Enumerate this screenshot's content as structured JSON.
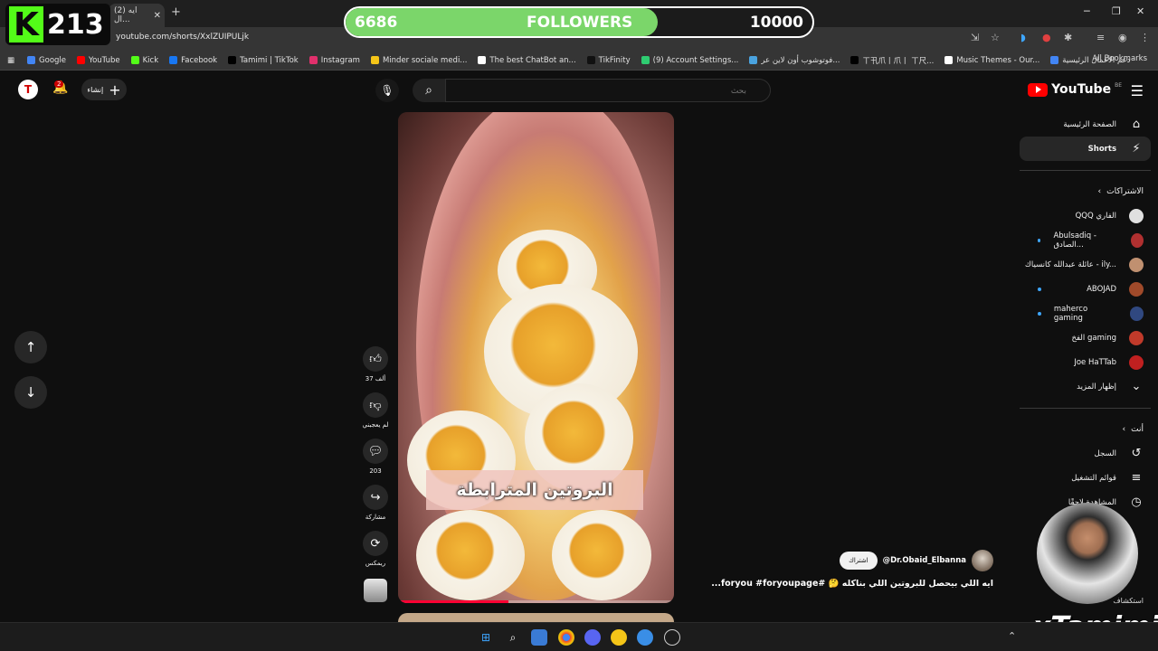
{
  "browser": {
    "tab_title": "(2) ايه ال...",
    "url": "youtube.com/shorts/XxlZUIPULjk",
    "bookmarks": [
      {
        "label": "Google",
        "color": "#4285f4"
      },
      {
        "label": "YouTube",
        "color": "#ff0000"
      },
      {
        "label": "Kick",
        "color": "#53fc18"
      },
      {
        "label": "Facebook",
        "color": "#1877f2"
      },
      {
        "label": "Tamimi | TikTok",
        "color": "#000000"
      },
      {
        "label": "Instagram",
        "color": "#e1306c"
      },
      {
        "label": "Minder sociale medi...",
        "color": "#f5c518"
      },
      {
        "label": "The best ChatBot an...",
        "color": "#ffffff"
      },
      {
        "label": "TikFinity",
        "color": "#111111"
      },
      {
        "label": "(9) Account Settings...",
        "color": "#2ecc71"
      },
      {
        "label": "فوتوشوب أون لاين عر...",
        "color": "#4aa3df"
      },
      {
        "label": "ㄒ卂爪丨爪丨 ㄒ尺...",
        "color": "#000000"
      },
      {
        "label": "Music Themes - Our...",
        "color": "#ffffff"
      },
      {
        "label": "دعم الأعمال الرئيسية",
        "color": "#4285f4"
      }
    ],
    "all_bookmarks": "All Bookmarks"
  },
  "overlay": {
    "kick_count": "213",
    "followers_current": "6686",
    "followers_label": "FOLLOWERS",
    "followers_goal": "10000",
    "followers_progress": 0.6686,
    "brand": "xTamimi"
  },
  "header": {
    "logo_text": "YouTube",
    "region": "BE",
    "search_placeholder": "بحث",
    "create_label": "إنشاء",
    "notification_count": "2"
  },
  "sidebar": {
    "home": "الصفحة الرئيسية",
    "shorts": "Shorts",
    "subscriptions_heading": "الاشتراكات",
    "subscriptions": [
      {
        "name": "QQQ الفاري",
        "color": "#e0e0e0",
        "new": false
      },
      {
        "name": "Abulsadiq - الصادق...",
        "color": "#b03030",
        "new": true
      },
      {
        "name": "عائلة عبدالله كانسياك - ily...",
        "color": "#c09070",
        "new": false
      },
      {
        "name": "ABOJAD",
        "color": "#a04a2a",
        "new": true
      },
      {
        "name": "maherco gaming",
        "color": "#304880",
        "new": true
      },
      {
        "name": "الفخ gaming",
        "color": "#c03a2a",
        "new": false
      },
      {
        "name": "Joe HaTTab",
        "color": "#c02020",
        "new": false
      }
    ],
    "show_more": "إظهار المزيد",
    "you_heading": "أنت",
    "history": "السجل",
    "playlists": "قوائم التشغيل",
    "watch_later": "المشاهدة لاحقًا",
    "explore": "استكشاف"
  },
  "short": {
    "caption": "البروتين المترابطة",
    "channel": "@Dr.Obaid_Elbanna",
    "subscribe": "اشتراك",
    "title": "ايه اللي بيحصل للبروتين اللي بناكله 🤔 #foryou #foryoupage...",
    "progress": 0.4,
    "likes": "37 ألف",
    "dislike_label": "لم يعجبني",
    "comments": "203",
    "share_label": "مشاركة",
    "remix_label": "ريمكس"
  }
}
